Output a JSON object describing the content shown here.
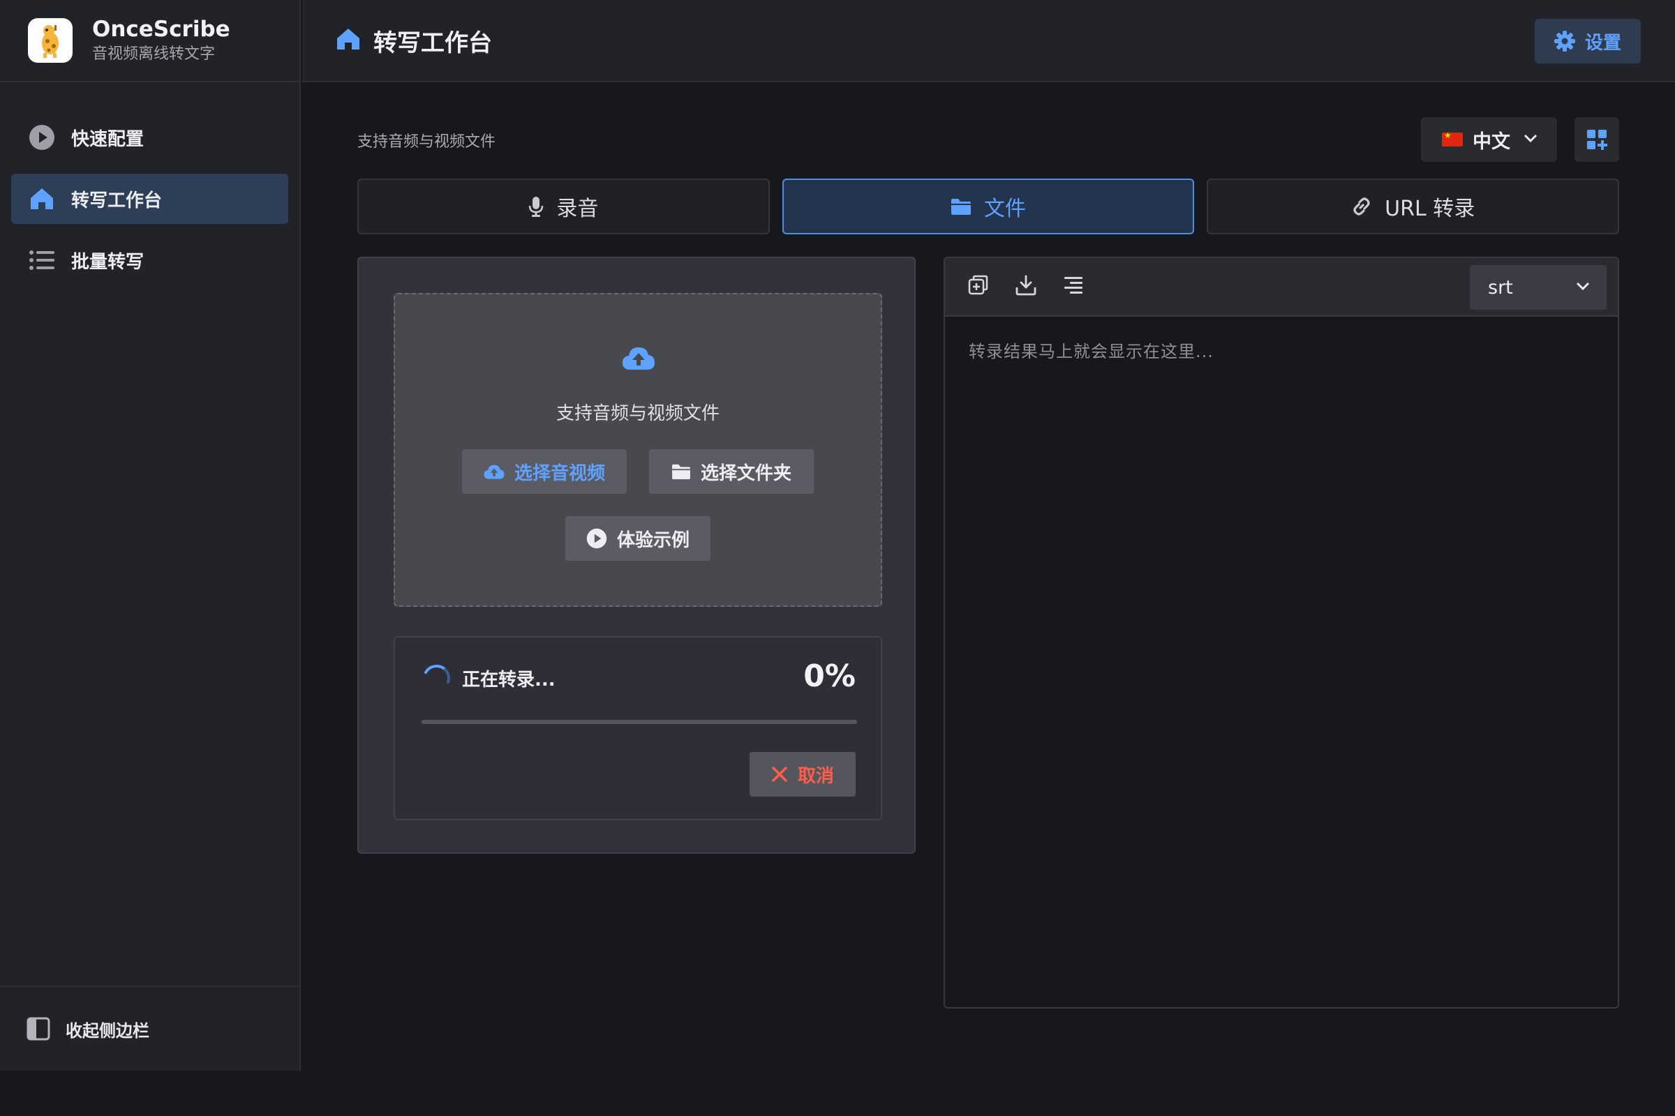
{
  "app": {
    "name": "OnceScribe",
    "subtitle": "音视频离线转文字"
  },
  "sidebar": {
    "items": [
      {
        "label": "快速配置",
        "icon": "play-circle-icon",
        "active": false
      },
      {
        "label": "转写工作台",
        "icon": "home-icon",
        "active": true
      },
      {
        "label": "批量转写",
        "icon": "list-icon",
        "active": false
      }
    ],
    "collapse_label": "收起侧边栏"
  },
  "header": {
    "title": "转写工作台",
    "settings_label": "设置"
  },
  "main": {
    "supported_label": "支持音频与视频文件",
    "language": "中文",
    "tabs": [
      {
        "label": "录音",
        "icon": "microphone-icon",
        "active": false
      },
      {
        "label": "文件",
        "icon": "folder-icon",
        "active": true
      },
      {
        "label": "URL 转录",
        "icon": "link-icon",
        "active": false
      }
    ]
  },
  "upload": {
    "hint": "支持音频与视频文件",
    "select_media_label": "选择音视频",
    "select_folder_label": "选择文件夹",
    "demo_label": "体验示例"
  },
  "progress": {
    "status": "正在转录...",
    "percent_text": "0%",
    "percent": 0,
    "cancel_label": "取消"
  },
  "result": {
    "format": "srt",
    "placeholder": "转录结果马上就会显示在这里..."
  },
  "colors": {
    "accent": "#5ea1ff",
    "danger": "#ff5d4a",
    "sidebar_active": "#2e3e57"
  }
}
